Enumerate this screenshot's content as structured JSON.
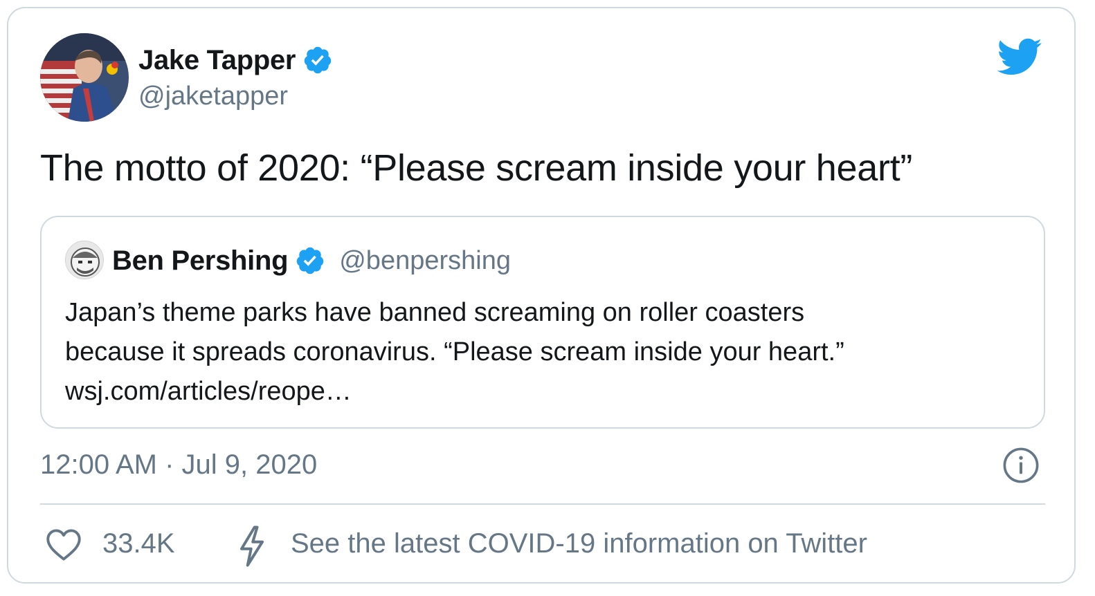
{
  "author": {
    "name": "Jake Tapper",
    "handle": "@jaketapper"
  },
  "tweet": {
    "text": "The motto of 2020: “Please scream inside your heart”",
    "timestamp": "12:00 AM · Jul 9, 2020"
  },
  "quoted_tweet": {
    "name": "Ben Pershing",
    "handle": "@benpershing",
    "lines": [
      "Japan’s theme parks have banned screaming on roller coasters",
      "because it spreads coronavirus. “Please scream inside your heart.”",
      "wsj.com/articles/reope…"
    ]
  },
  "actions": {
    "like_count": "33.4K",
    "covid_link": "See the latest COVID-19 information on Twitter"
  },
  "colors": {
    "twitter_blue": "#1da1f2",
    "secondary_text": "#657786",
    "border": "#cfd9de"
  },
  "icons": [
    "verified-badge-icon",
    "twitter-bird-icon",
    "info-icon",
    "heart-icon",
    "lightning-bolt-icon"
  ]
}
